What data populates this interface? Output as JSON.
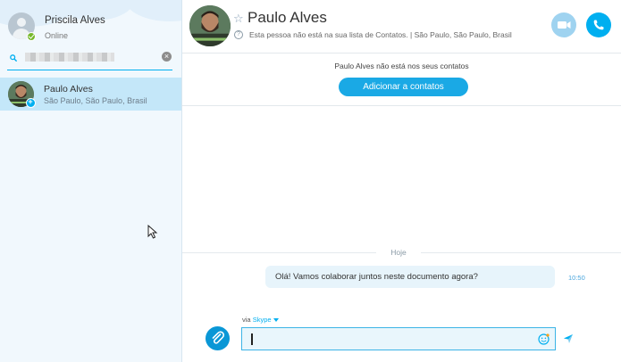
{
  "sidebar": {
    "profile": {
      "name": "Priscila Alves",
      "status": "Online"
    },
    "search": {
      "value": ""
    },
    "contacts": [
      {
        "name": "Paulo Alves",
        "location": "São Paulo, São Paulo, Brasil"
      }
    ]
  },
  "header": {
    "name": "Paulo Alves",
    "subtitle": "Esta pessoa não está na sua lista de Contatos.  |  São Paulo, São Paulo, Brasil"
  },
  "notice": {
    "text": "Paulo Alves não está nos seus contatos",
    "button": "Adicionar a contatos"
  },
  "chat": {
    "day_label": "Hoje",
    "messages": [
      {
        "text": "Olá! Vamos colaborar juntos neste documento agora?",
        "time": "10:50"
      }
    ]
  },
  "composer": {
    "via_prefix": "via",
    "via_service": "Skype",
    "value": ""
  },
  "colors": {
    "accent": "#00aff0",
    "selected_row": "#c4e7f9",
    "bubble": "#e7f4fb",
    "online": "#76b82a"
  },
  "icons": [
    "person-icon",
    "online-check-icon",
    "search-icon",
    "clear-icon",
    "add-contact-badge-icon",
    "star-icon",
    "info-icon",
    "video-call-icon",
    "phone-call-icon",
    "paperclip-icon",
    "emoji-icon",
    "send-icon",
    "mouse-cursor-icon"
  ]
}
